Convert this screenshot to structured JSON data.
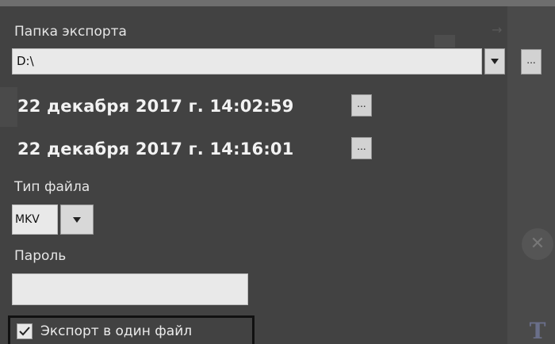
{
  "export_folder": {
    "label": "Папка экспорта",
    "value": "D:\\",
    "browse_label": "..."
  },
  "period": {
    "start": "22 декабря 2017 г. 14:02:59",
    "end": "22 декабря 2017 г. 14:16:01",
    "edit_label": "..."
  },
  "file_type": {
    "label": "Тип файла",
    "value": "MKV"
  },
  "password": {
    "label": "Пароль",
    "value": ""
  },
  "single_file": {
    "label": "Экспорт в один файл",
    "checked": true
  },
  "icons": {
    "dropdown": "chevron-down-icon",
    "check": "check-icon",
    "close": "close-icon"
  },
  "colors": {
    "panel": "#424242",
    "text": "#e6e6e6",
    "input_bg": "#e9e9e9"
  }
}
